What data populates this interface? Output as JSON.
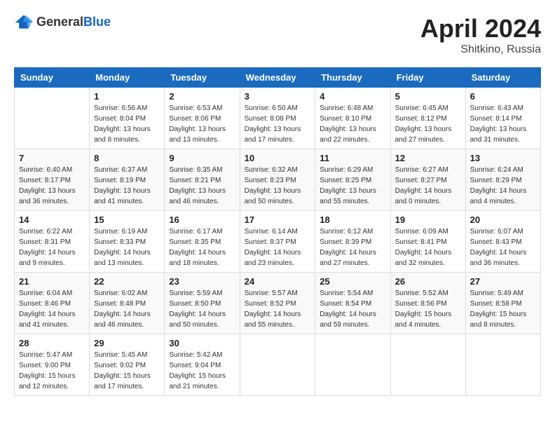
{
  "header": {
    "logo_general": "General",
    "logo_blue": "Blue",
    "title": "April 2024",
    "location": "Shitkino, Russia"
  },
  "calendar": {
    "columns": [
      "Sunday",
      "Monday",
      "Tuesday",
      "Wednesday",
      "Thursday",
      "Friday",
      "Saturday"
    ],
    "weeks": [
      [
        {
          "day": "",
          "info": ""
        },
        {
          "day": "1",
          "info": "Sunrise: 6:56 AM\nSunset: 8:04 PM\nDaylight: 13 hours\nand 8 minutes."
        },
        {
          "day": "2",
          "info": "Sunrise: 6:53 AM\nSunset: 8:06 PM\nDaylight: 13 hours\nand 13 minutes."
        },
        {
          "day": "3",
          "info": "Sunrise: 6:50 AM\nSunset: 8:08 PM\nDaylight: 13 hours\nand 17 minutes."
        },
        {
          "day": "4",
          "info": "Sunrise: 6:48 AM\nSunset: 8:10 PM\nDaylight: 13 hours\nand 22 minutes."
        },
        {
          "day": "5",
          "info": "Sunrise: 6:45 AM\nSunset: 8:12 PM\nDaylight: 13 hours\nand 27 minutes."
        },
        {
          "day": "6",
          "info": "Sunrise: 6:43 AM\nSunset: 8:14 PM\nDaylight: 13 hours\nand 31 minutes."
        }
      ],
      [
        {
          "day": "7",
          "info": "Sunrise: 6:40 AM\nSunset: 8:17 PM\nDaylight: 13 hours\nand 36 minutes."
        },
        {
          "day": "8",
          "info": "Sunrise: 6:37 AM\nSunset: 8:19 PM\nDaylight: 13 hours\nand 41 minutes."
        },
        {
          "day": "9",
          "info": "Sunrise: 6:35 AM\nSunset: 8:21 PM\nDaylight: 13 hours\nand 46 minutes."
        },
        {
          "day": "10",
          "info": "Sunrise: 6:32 AM\nSunset: 8:23 PM\nDaylight: 13 hours\nand 50 minutes."
        },
        {
          "day": "11",
          "info": "Sunrise: 6:29 AM\nSunset: 8:25 PM\nDaylight: 13 hours\nand 55 minutes."
        },
        {
          "day": "12",
          "info": "Sunrise: 6:27 AM\nSunset: 8:27 PM\nDaylight: 14 hours\nand 0 minutes."
        },
        {
          "day": "13",
          "info": "Sunrise: 6:24 AM\nSunset: 8:29 PM\nDaylight: 14 hours\nand 4 minutes."
        }
      ],
      [
        {
          "day": "14",
          "info": "Sunrise: 6:22 AM\nSunset: 8:31 PM\nDaylight: 14 hours\nand 9 minutes."
        },
        {
          "day": "15",
          "info": "Sunrise: 6:19 AM\nSunset: 8:33 PM\nDaylight: 14 hours\nand 13 minutes."
        },
        {
          "day": "16",
          "info": "Sunrise: 6:17 AM\nSunset: 8:35 PM\nDaylight: 14 hours\nand 18 minutes."
        },
        {
          "day": "17",
          "info": "Sunrise: 6:14 AM\nSunset: 8:37 PM\nDaylight: 14 hours\nand 23 minutes."
        },
        {
          "day": "18",
          "info": "Sunrise: 6:12 AM\nSunset: 8:39 PM\nDaylight: 14 hours\nand 27 minutes."
        },
        {
          "day": "19",
          "info": "Sunrise: 6:09 AM\nSunset: 8:41 PM\nDaylight: 14 hours\nand 32 minutes."
        },
        {
          "day": "20",
          "info": "Sunrise: 6:07 AM\nSunset: 8:43 PM\nDaylight: 14 hours\nand 36 minutes."
        }
      ],
      [
        {
          "day": "21",
          "info": "Sunrise: 6:04 AM\nSunset: 8:46 PM\nDaylight: 14 hours\nand 41 minutes."
        },
        {
          "day": "22",
          "info": "Sunrise: 6:02 AM\nSunset: 8:48 PM\nDaylight: 14 hours\nand 46 minutes."
        },
        {
          "day": "23",
          "info": "Sunrise: 5:59 AM\nSunset: 8:50 PM\nDaylight: 14 hours\nand 50 minutes."
        },
        {
          "day": "24",
          "info": "Sunrise: 5:57 AM\nSunset: 8:52 PM\nDaylight: 14 hours\nand 55 minutes."
        },
        {
          "day": "25",
          "info": "Sunrise: 5:54 AM\nSunset: 8:54 PM\nDaylight: 14 hours\nand 59 minutes."
        },
        {
          "day": "26",
          "info": "Sunrise: 5:52 AM\nSunset: 8:56 PM\nDaylight: 15 hours\nand 4 minutes."
        },
        {
          "day": "27",
          "info": "Sunrise: 5:49 AM\nSunset: 8:58 PM\nDaylight: 15 hours\nand 8 minutes."
        }
      ],
      [
        {
          "day": "28",
          "info": "Sunrise: 5:47 AM\nSunset: 9:00 PM\nDaylight: 15 hours\nand 12 minutes."
        },
        {
          "day": "29",
          "info": "Sunrise: 5:45 AM\nSunset: 9:02 PM\nDaylight: 15 hours\nand 17 minutes."
        },
        {
          "day": "30",
          "info": "Sunrise: 5:42 AM\nSunset: 9:04 PM\nDaylight: 15 hours\nand 21 minutes."
        },
        {
          "day": "",
          "info": ""
        },
        {
          "day": "",
          "info": ""
        },
        {
          "day": "",
          "info": ""
        },
        {
          "day": "",
          "info": ""
        }
      ]
    ]
  }
}
